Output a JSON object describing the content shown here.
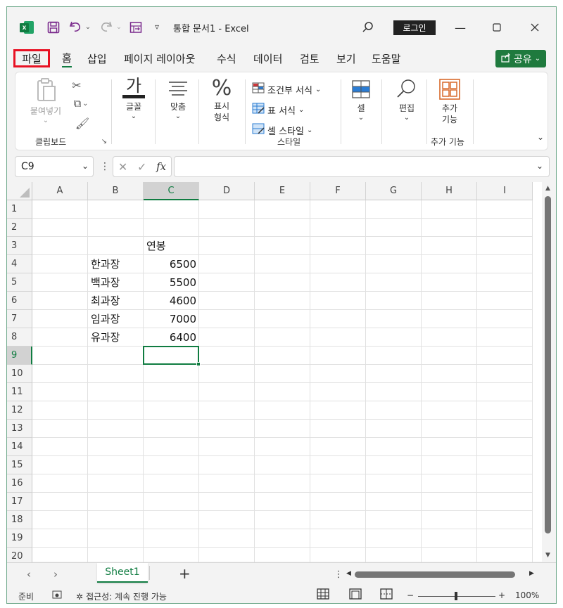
{
  "titlebar": {
    "app_icon": "excel-logo-icon",
    "save_icon": "save-icon",
    "undo_icon": "undo-icon",
    "redo_icon": "redo-icon",
    "customize_icon": "customize-qat-icon",
    "title": "통합 문서1  -  Excel",
    "search_icon": "search-icon",
    "login_label": "로그인",
    "minimize_icon": "minimize-icon",
    "maximize_icon": "maximize-icon",
    "close_icon": "close-icon"
  },
  "menu": {
    "tabs": [
      "파일",
      "홈",
      "삽입",
      "페이지 레이아웃",
      "수식",
      "데이터",
      "검토",
      "보기",
      "도움말"
    ],
    "share_label": "공유"
  },
  "ribbon": {
    "clipboard": {
      "paste": "붙여넣기",
      "group": "클립보드"
    },
    "font": "글꼴",
    "align": "맞춤",
    "number": {
      "line1": "표시",
      "line2": "형식"
    },
    "styles": {
      "conditional": "조건부 서식",
      "table": "표 서식",
      "cell_style": "셀 스타일",
      "group": "스타일"
    },
    "cells": "셀",
    "editing": "편집",
    "addins": {
      "line1": "추가",
      "line2": "기능",
      "group": "추가 기능"
    }
  },
  "formula_bar": {
    "name_box": "C9",
    "formula": ""
  },
  "grid": {
    "columns": [
      "A",
      "B",
      "C",
      "D",
      "E",
      "F",
      "G",
      "H",
      "I"
    ],
    "rows": [
      "1",
      "2",
      "3",
      "4",
      "5",
      "6",
      "7",
      "8",
      "9",
      "10",
      "11",
      "12",
      "13",
      "14",
      "15",
      "16",
      "17",
      "18",
      "19",
      "20"
    ],
    "selected_column": "C",
    "selected_row": "9",
    "cells": {
      "C3": "연봉",
      "B4": "한과장",
      "C4": "6500",
      "B5": "백과장",
      "C5": "5500",
      "B6": "최과장",
      "C6": "4600",
      "B7": "임과장",
      "C7": "7000",
      "B8": "유과장",
      "C8": "6400"
    }
  },
  "sheets": {
    "active": "Sheet1",
    "add_label": "+"
  },
  "status": {
    "ready": "준비",
    "accessibility": "접근성: 계속 진행 가능",
    "zoom": "100%",
    "zoom_minus": "−",
    "zoom_plus": "+"
  }
}
